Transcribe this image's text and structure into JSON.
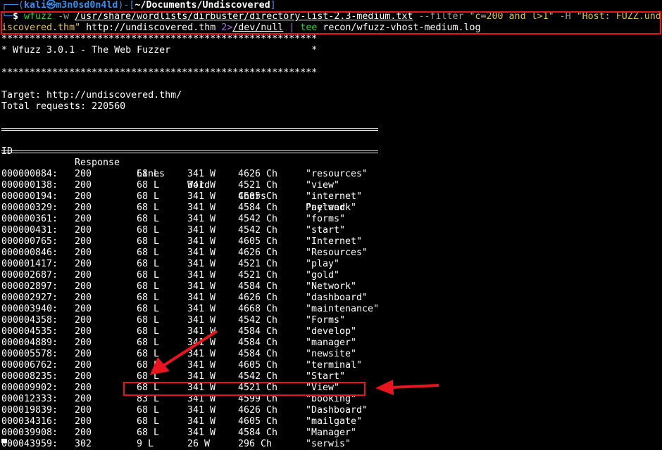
{
  "prompt": {
    "corner_top": "┌──(",
    "user_host": "kali㉿m3n0sd0n4ld",
    "mid": ")-[",
    "cwd": "~/Documents/Undiscovered",
    "close": "]",
    "corner_bottom": "└─",
    "dollar": "$ "
  },
  "command": {
    "bin": "wfuzz",
    "flag_w": "-w",
    "wordlist": "/usr/share/wordlists/dirbuster/directory-list-2.3-medium.txt",
    "flag_filter": "--filter",
    "filter_value": "\"c=200 and l>1\"",
    "flag_h": "-H",
    "header_part1": "\"Host: FUZZ.und",
    "header_part2": "iscovered.thm\"",
    "url": "http://undiscovered.thm",
    "redirect": "2>",
    "devnull": "/dev/null",
    "pipe": "|",
    "tee": "tee",
    "logfile": "recon/wfuzz-vhost-medium.log"
  },
  "banner": {
    "stars": "********************************************************",
    "title": "* Wfuzz 3.0.1 - The Web Fuzzer                         *"
  },
  "info": {
    "target": "Target: http://undiscovered.thm/",
    "total": "Total requests: 220560"
  },
  "headers": {
    "id": "ID",
    "response": "Response",
    "lines": "Lines",
    "word": "Word",
    "chars": "Chars",
    "payload": "Payload"
  },
  "results": [
    {
      "id": "000000084:",
      "response": "200",
      "lines": "68 L",
      "word": "341 W",
      "chars": "4626 Ch",
      "payload": "\"resources\""
    },
    {
      "id": "000000138:",
      "response": "200",
      "lines": "68 L",
      "word": "341 W",
      "chars": "4521 Ch",
      "payload": "\"view\""
    },
    {
      "id": "000000194:",
      "response": "200",
      "lines": "68 L",
      "word": "341 W",
      "chars": "4605 Ch",
      "payload": "\"internet\""
    },
    {
      "id": "000000329:",
      "response": "200",
      "lines": "68 L",
      "word": "341 W",
      "chars": "4584 Ch",
      "payload": "\"network\""
    },
    {
      "id": "000000361:",
      "response": "200",
      "lines": "68 L",
      "word": "341 W",
      "chars": "4542 Ch",
      "payload": "\"forms\""
    },
    {
      "id": "000000431:",
      "response": "200",
      "lines": "68 L",
      "word": "341 W",
      "chars": "4542 Ch",
      "payload": "\"start\""
    },
    {
      "id": "000000765:",
      "response": "200",
      "lines": "68 L",
      "word": "341 W",
      "chars": "4605 Ch",
      "payload": "\"Internet\""
    },
    {
      "id": "000000846:",
      "response": "200",
      "lines": "68 L",
      "word": "341 W",
      "chars": "4626 Ch",
      "payload": "\"Resources\""
    },
    {
      "id": "000001417:",
      "response": "200",
      "lines": "68 L",
      "word": "341 W",
      "chars": "4521 Ch",
      "payload": "\"play\""
    },
    {
      "id": "000002687:",
      "response": "200",
      "lines": "68 L",
      "word": "341 W",
      "chars": "4521 Ch",
      "payload": "\"gold\""
    },
    {
      "id": "000002897:",
      "response": "200",
      "lines": "68 L",
      "word": "341 W",
      "chars": "4584 Ch",
      "payload": "\"Network\""
    },
    {
      "id": "000002927:",
      "response": "200",
      "lines": "68 L",
      "word": "341 W",
      "chars": "4626 Ch",
      "payload": "\"dashboard\""
    },
    {
      "id": "000003940:",
      "response": "200",
      "lines": "68 L",
      "word": "341 W",
      "chars": "4668 Ch",
      "payload": "\"maintenance\""
    },
    {
      "id": "000004358:",
      "response": "200",
      "lines": "68 L",
      "word": "341 W",
      "chars": "4542 Ch",
      "payload": "\"Forms\""
    },
    {
      "id": "000004535:",
      "response": "200",
      "lines": "68 L",
      "word": "341 W",
      "chars": "4584 Ch",
      "payload": "\"develop\""
    },
    {
      "id": "000004889:",
      "response": "200",
      "lines": "68 L",
      "word": "341 W",
      "chars": "4584 Ch",
      "payload": "\"manager\""
    },
    {
      "id": "000005578:",
      "response": "200",
      "lines": "68 L",
      "word": "341 W",
      "chars": "4584 Ch",
      "payload": "\"newsite\""
    },
    {
      "id": "000006762:",
      "response": "200",
      "lines": "68 L",
      "word": "341 W",
      "chars": "4605 Ch",
      "payload": "\"terminal\""
    },
    {
      "id": "000008235:",
      "response": "200",
      "lines": "68 L",
      "word": "341 W",
      "chars": "4542 Ch",
      "payload": "\"Start\""
    },
    {
      "id": "000009902:",
      "response": "200",
      "lines": "68 L",
      "word": "341 W",
      "chars": "4521 Ch",
      "payload": "\"View\""
    },
    {
      "id": "000012333:",
      "response": "200",
      "lines": "83 L",
      "word": "341 W",
      "chars": "4599 Ch",
      "payload": "\"booking\""
    },
    {
      "id": "000019839:",
      "response": "200",
      "lines": "68 L",
      "word": "341 W",
      "chars": "4626 Ch",
      "payload": "\"Dashboard\""
    },
    {
      "id": "000034316:",
      "response": "200",
      "lines": "68 L",
      "word": "341 W",
      "chars": "4605 Ch",
      "payload": "\"mailgate\""
    },
    {
      "id": "000039908:",
      "response": "200",
      "lines": "68 L",
      "word": "341 W",
      "chars": "4584 Ch",
      "payload": "\"Manager\""
    },
    {
      "id": "000043959:",
      "response": "302",
      "lines": "9 L",
      "word": "26 W",
      "chars": "296 Ch",
      "payload": "\"serwis\""
    }
  ],
  "colors": {
    "background": "#000000",
    "prompt_blue": "#3b8eea",
    "green": "#36d13b",
    "yellow": "#e0c24a",
    "annotation_red": "#e8141e"
  },
  "icons": {
    "cursor": "block-cursor",
    "annotation": "red-arrow"
  }
}
